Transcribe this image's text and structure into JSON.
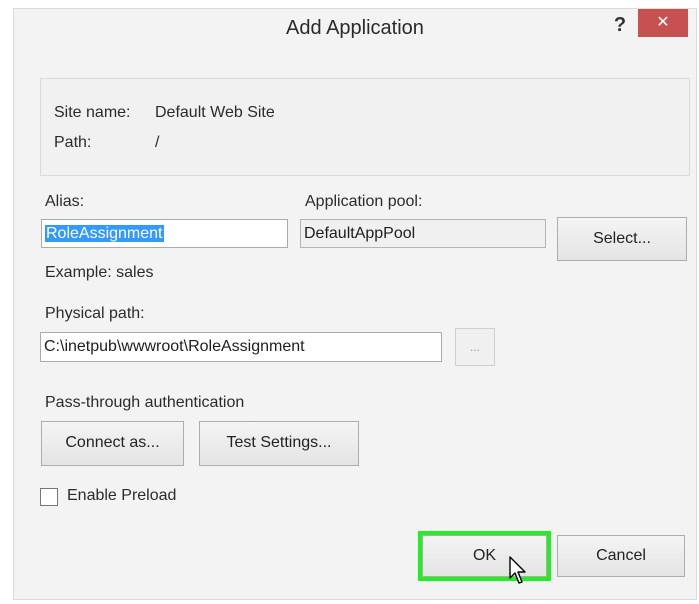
{
  "window": {
    "title": "Add Application",
    "help_label": "?",
    "close_label": "✕"
  },
  "site_info": {
    "site_name_label": "Site name:",
    "site_name_value": "Default Web Site",
    "path_label": "Path:",
    "path_value": "/"
  },
  "alias": {
    "label": "Alias:",
    "value": "RoleAssignment",
    "example": "Example: sales"
  },
  "app_pool": {
    "label": "Application pool:",
    "value": "DefaultAppPool",
    "select_button": "Select..."
  },
  "physical_path": {
    "label": "Physical path:",
    "value": "C:\\inetpub\\wwwroot\\RoleAssignment",
    "browse_button": "..."
  },
  "auth": {
    "label": "Pass-through authentication",
    "connect_button": "Connect as...",
    "test_button": "Test Settings..."
  },
  "preload": {
    "label": "Enable Preload",
    "checked": false
  },
  "footer": {
    "ok_button": "OK",
    "cancel_button": "Cancel",
    "highlight_color": "#22ee22"
  }
}
